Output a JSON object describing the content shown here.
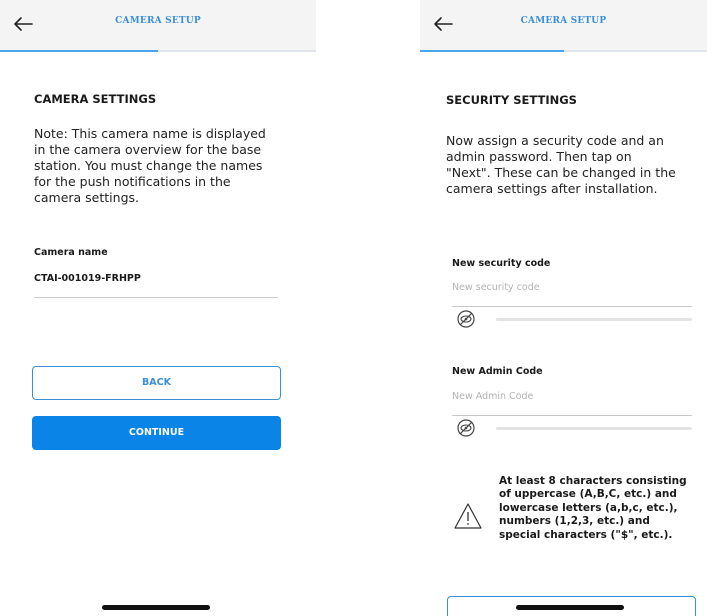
{
  "left": {
    "header_title": "CAMERA SETUP",
    "progress": 0.5,
    "section_title": "CAMERA SETTINGS",
    "note_lines": [
      "Note: This camera name is displayed",
      "in the camera overview for the base",
      "station. You must change the names",
      "for the push notifications in the",
      "camera settings."
    ],
    "camera_name_label": "Camera name",
    "camera_name_value": "CTAI-001019-FRHPP",
    "back_label": "BACK",
    "continue_label": "CONTINUE"
  },
  "right": {
    "header_title": "CAMERA SETUP",
    "progress": 0.5,
    "section_title": "SECURITY SETTINGS",
    "intro_lines": [
      "Now assign a security code and an",
      "admin password. Then tap on",
      "\"Next\". These can be changed in the",
      "camera settings after installation."
    ],
    "security_code_label": "New security code",
    "security_code_placeholder": "New security code",
    "admin_code_label": "New Admin Code",
    "admin_code_placeholder": "New Admin Code",
    "hint_lines": [
      "At least 8 characters consisting",
      "of uppercase (A,B,C, etc.) and",
      "lowercase letters (a,b,c, etc.),",
      "numbers (1,2,3, etc.) and",
      "special characters (\"$\", etc.)."
    ]
  },
  "icons": {
    "back": "arrow-left-icon",
    "eye": "eye-slash-icon",
    "warning": "warning-triangle-icon"
  },
  "colors": {
    "accent": "#3a8fd8",
    "button_fill": "#0a84e6",
    "header_bg": "#f4f4f4"
  }
}
